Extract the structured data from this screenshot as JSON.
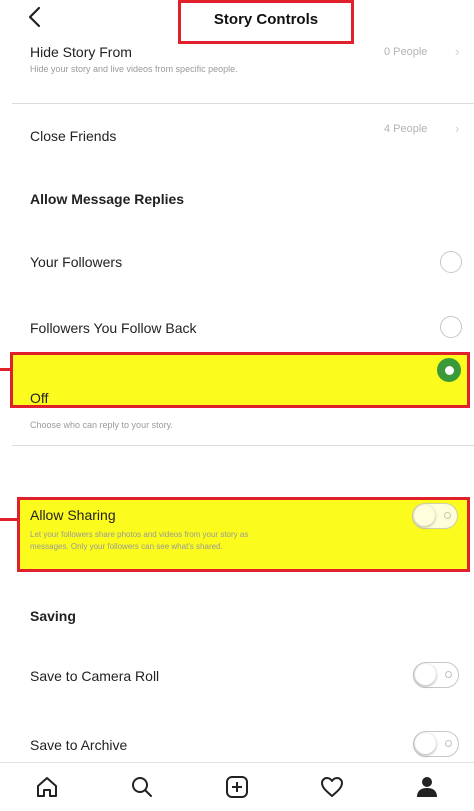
{
  "header": {
    "title": "Story Controls"
  },
  "hide_story": {
    "label": "Hide Story From",
    "sub": "Hide your story and live videos from specific people.",
    "value": "0 People"
  },
  "close_friends": {
    "label": "Close Friends",
    "value": "4 People"
  },
  "message_replies": {
    "title": "Allow Message Replies",
    "options": [
      {
        "label": "Your Followers",
        "selected": false
      },
      {
        "label": "Followers You Follow Back",
        "selected": false
      },
      {
        "label": "Off",
        "selected": true
      }
    ],
    "help": "Choose who can reply to your story."
  },
  "allow_sharing": {
    "label": "Allow Sharing",
    "sub_line1": "Let your followers share photos and videos from your story as",
    "sub_line2": "messages. Only your followers can see what's shared.",
    "enabled": false
  },
  "saving": {
    "title": "Saving",
    "camera_roll": {
      "label": "Save to Camera Roll",
      "enabled": false
    },
    "archive": {
      "label": "Save to Archive",
      "enabled": false
    }
  },
  "tabbar": {
    "icons": [
      "home-icon",
      "search-icon",
      "add-post-icon",
      "heart-icon",
      "profile-icon"
    ]
  },
  "colors": {
    "highlight": "#fbfb1d",
    "annotation_red": "#e0202a",
    "selected_green": "#3a9a3a"
  }
}
